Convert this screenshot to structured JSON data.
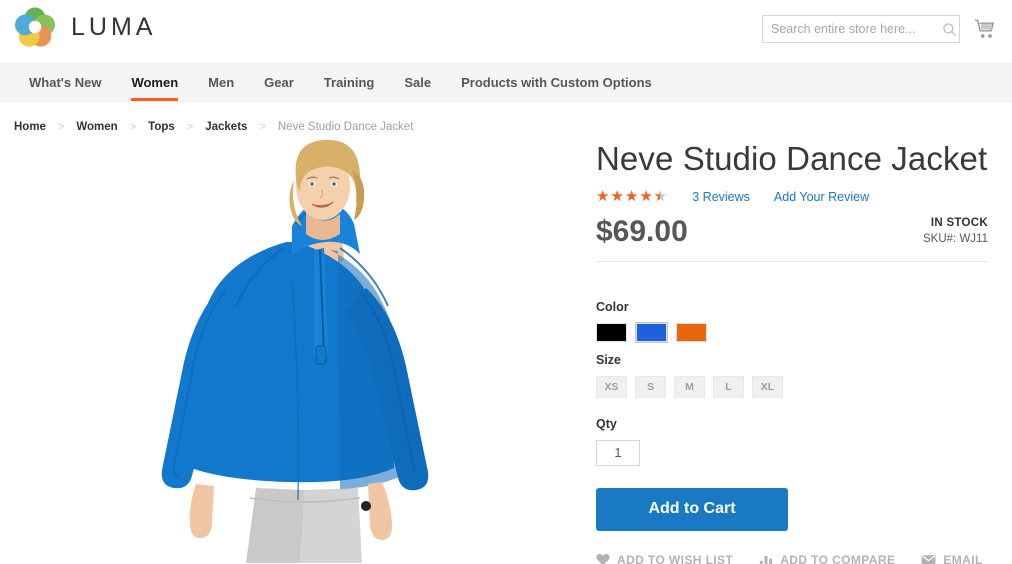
{
  "header": {
    "brand": "LUMA",
    "logo_icon": "luma-ring-logo",
    "search": {
      "placeholder": "Search entire store here...",
      "value": "",
      "icon": "search-icon"
    },
    "cart_icon": "shopping-cart-icon"
  },
  "nav": {
    "items": [
      {
        "label": "What's New",
        "active": false
      },
      {
        "label": "Women",
        "active": true
      },
      {
        "label": "Men",
        "active": false
      },
      {
        "label": "Gear",
        "active": false
      },
      {
        "label": "Training",
        "active": false
      },
      {
        "label": "Sale",
        "active": false
      },
      {
        "label": "Products with Custom Options",
        "active": false
      }
    ],
    "active_color": "#f4601e"
  },
  "breadcrumb": {
    "items": [
      "Home",
      "Women",
      "Tops",
      "Jackets",
      "Neve Studio Dance Jacket"
    ],
    "separator": ">"
  },
  "product": {
    "title": "Neve Studio Dance Jacket",
    "rating_percent": 88,
    "reviews_label": "3 Reviews",
    "add_review_label": "Add Your Review",
    "price": "$69.00",
    "stock_status": "IN STOCK",
    "sku": "SKU#:  WJ11",
    "image_alt": "Woman wearing blue quarter-zip dance jacket",
    "color": {
      "label": "Color",
      "options": [
        {
          "name": "Black",
          "hex": "#000000",
          "selected": false
        },
        {
          "name": "Blue",
          "hex": "#1f5fe0",
          "selected": true
        },
        {
          "name": "Orange",
          "hex": "#e8670d",
          "selected": false
        }
      ]
    },
    "size": {
      "label": "Size",
      "options": [
        "XS",
        "S",
        "M",
        "L",
        "XL"
      ]
    },
    "qty": {
      "label": "Qty",
      "value": "1"
    },
    "add_to_cart_label": "Add to Cart",
    "actions": [
      {
        "label": "ADD TO WISH LIST",
        "icon": "heart-icon"
      },
      {
        "label": "ADD TO COMPARE",
        "icon": "bar-chart-icon"
      },
      {
        "label": "EMAIL",
        "icon": "envelope-icon"
      }
    ]
  },
  "colors": {
    "accent_orange": "#f4601e",
    "link_blue": "#1979c3",
    "button_blue": "#1979c3"
  }
}
